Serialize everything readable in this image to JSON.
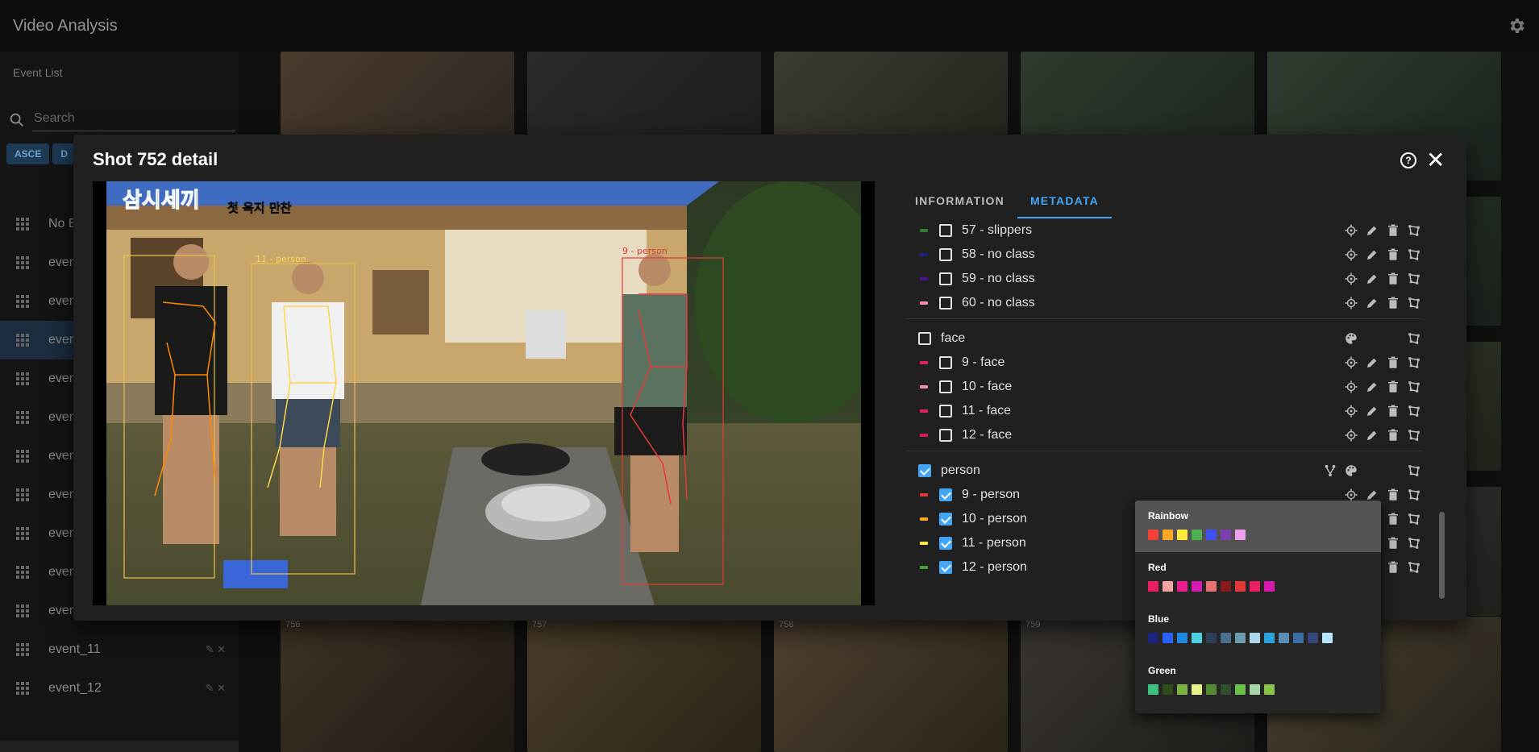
{
  "app": {
    "title": "Video Analysis"
  },
  "sidebar": {
    "section_label": "Event List",
    "search_placeholder": "Search",
    "sort": [
      "ASCE",
      "D"
    ],
    "items": [
      {
        "label": "No E",
        "active": false
      },
      {
        "label": "event",
        "active": false
      },
      {
        "label": "event",
        "active": false
      },
      {
        "label": "event",
        "active": true
      },
      {
        "label": "event",
        "active": false
      },
      {
        "label": "event",
        "active": false
      },
      {
        "label": "event",
        "active": false
      },
      {
        "label": "event",
        "active": false
      },
      {
        "label": "event",
        "active": false
      },
      {
        "label": "event",
        "active": false
      },
      {
        "label": "event_10",
        "active": false
      },
      {
        "label": "event_11",
        "active": false
      },
      {
        "label": "event_12",
        "active": false
      }
    ]
  },
  "thumbnails": {
    "numbers": [
      "756",
      "757",
      "758",
      "759"
    ]
  },
  "modal": {
    "title": "Shot 752 detail",
    "help_label": "?",
    "close_label": "✕",
    "video": {
      "overlay_title": "삼시세끼",
      "overlay_subtitle": "첫 육지 만찬",
      "box_labels": [
        "9 - person",
        "11 - person"
      ]
    },
    "tabs": [
      {
        "label": "INFORMATION",
        "active": false
      },
      {
        "label": "METADATA",
        "active": true
      }
    ],
    "metadata": {
      "rows": [
        {
          "kind": "item",
          "label": "57 - slippers",
          "color": "#2e7d32",
          "checked": false
        },
        {
          "kind": "item",
          "label": "58 - no class",
          "color": "#1a237e",
          "checked": false
        },
        {
          "kind": "item",
          "label": "59 - no class",
          "color": "#4a148c",
          "checked": false
        },
        {
          "kind": "item",
          "label": "60 - no class",
          "color": "#f48fb1",
          "checked": false
        },
        {
          "kind": "group",
          "label": "face",
          "checked": false
        },
        {
          "kind": "item",
          "label": "9 - face",
          "color": "#e91e63",
          "checked": false
        },
        {
          "kind": "item",
          "label": "10 - face",
          "color": "#f48fb1",
          "checked": false
        },
        {
          "kind": "item",
          "label": "11 - face",
          "color": "#e91e63",
          "checked": false
        },
        {
          "kind": "item",
          "label": "12 - face",
          "color": "#d81b60",
          "checked": false
        },
        {
          "kind": "group",
          "label": "person",
          "checked": true
        },
        {
          "kind": "item",
          "label": "9 - person",
          "color": "#e53935",
          "checked": true
        },
        {
          "kind": "item",
          "label": "10 - person",
          "color": "#ffa726",
          "checked": true
        },
        {
          "kind": "item",
          "label": "11 - person",
          "color": "#ffeb3b",
          "checked": true
        },
        {
          "kind": "item",
          "label": "12 - person",
          "color": "#43a047",
          "checked": true
        }
      ]
    }
  },
  "palette_menu": {
    "palettes": [
      {
        "name": "Rainbow",
        "selected": true,
        "colors": [
          "#f44336",
          "#ffa726",
          "#ffeb3b",
          "#4caf50",
          "#3f51f5",
          "#7b3fb0",
          "#f0a0f0"
        ]
      },
      {
        "name": "Red",
        "selected": false,
        "colors": [
          "#e91e63",
          "#f4a3a3",
          "#e91e8c",
          "#d81bb0",
          "#e57373",
          "#8b1a1a",
          "#e53935",
          "#e91e63",
          "#d81bb0"
        ]
      },
      {
        "name": "Blue",
        "selected": false,
        "colors": [
          "#1a237e",
          "#2962ff",
          "#1e88e5",
          "#4dd0e1",
          "#2c3e5a",
          "#4a6f8f",
          "#6a9bb0",
          "#a8d8ea",
          "#29a3e0",
          "#5b8fb9",
          "#3a6ea5",
          "#34497a",
          "#b3e5fc"
        ]
      },
      {
        "name": "Green",
        "selected": false,
        "colors": [
          "#3fbf80",
          "#2e4d1a",
          "#7cb342",
          "#e6f28a",
          "#558b2f",
          "#2f4f2f",
          "#6abf4b",
          "#a5d6a7",
          "#8bc34a"
        ]
      }
    ]
  }
}
